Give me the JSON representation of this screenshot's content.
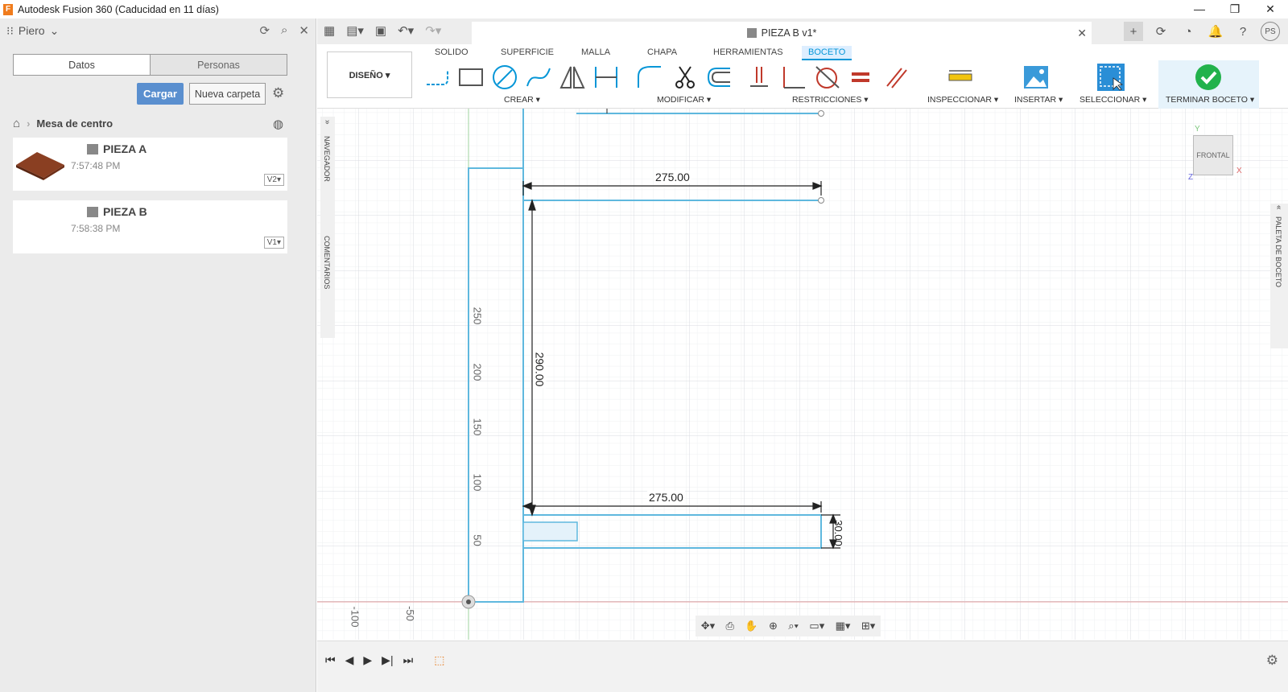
{
  "window": {
    "title": "Autodesk Fusion 360 (Caducidad en 11 días)",
    "logo": "F",
    "minimize": "—",
    "maximize": "❐",
    "close": "✕"
  },
  "data_panel": {
    "user": "Piero",
    "tabs": [
      "Datos",
      "Personas"
    ],
    "upload_label": "Cargar",
    "new_folder_label": "Nueva carpeta",
    "breadcrumb": "Mesa de centro",
    "items": [
      {
        "name": "PIEZA A",
        "time": "7:57:48 PM",
        "version": "V2▾"
      },
      {
        "name": "PIEZA B",
        "time": "7:58:38 PM",
        "version": "V1▾"
      }
    ]
  },
  "document": {
    "title": "PIEZA B v1*",
    "close": "✕",
    "user_initials": "PS"
  },
  "ribbon": {
    "workspace": "DISEÑO ▾",
    "tabs": [
      "SOLIDO",
      "SUPERFICIE",
      "MALLA",
      "CHAPA",
      "HERRAMIENTAS",
      "BOCETO"
    ],
    "active_tab": "BOCETO",
    "groups": [
      "CREAR ▾",
      "MODIFICAR ▾",
      "RESTRICCIONES ▾",
      "INSPECCIONAR ▾",
      "INSERTAR ▾",
      "SELECCIONAR ▾",
      "TERMINAR BOCETO ▾"
    ]
  },
  "side": {
    "navigator": "NAVEGADOR",
    "comments": "COMENTARIOS",
    "palette": "PALETA DE BOCETO"
  },
  "viewcube": {
    "face": "FRONTAL",
    "y": "Y",
    "x": "X",
    "z": "Z"
  },
  "sketch": {
    "dim_top": "275.00",
    "dim_bottom": "275.00",
    "dim_vertical": "290.00",
    "dim_small": "30.00",
    "ruler_y": [
      "250",
      "200",
      "150",
      "100",
      "50"
    ],
    "ruler_x": [
      "-100",
      "-50"
    ]
  },
  "colors": {
    "accent": "#0696d7",
    "sketch_line": "#5fb8de",
    "upload": "#5a8fcf",
    "finish": "#22b24c"
  }
}
